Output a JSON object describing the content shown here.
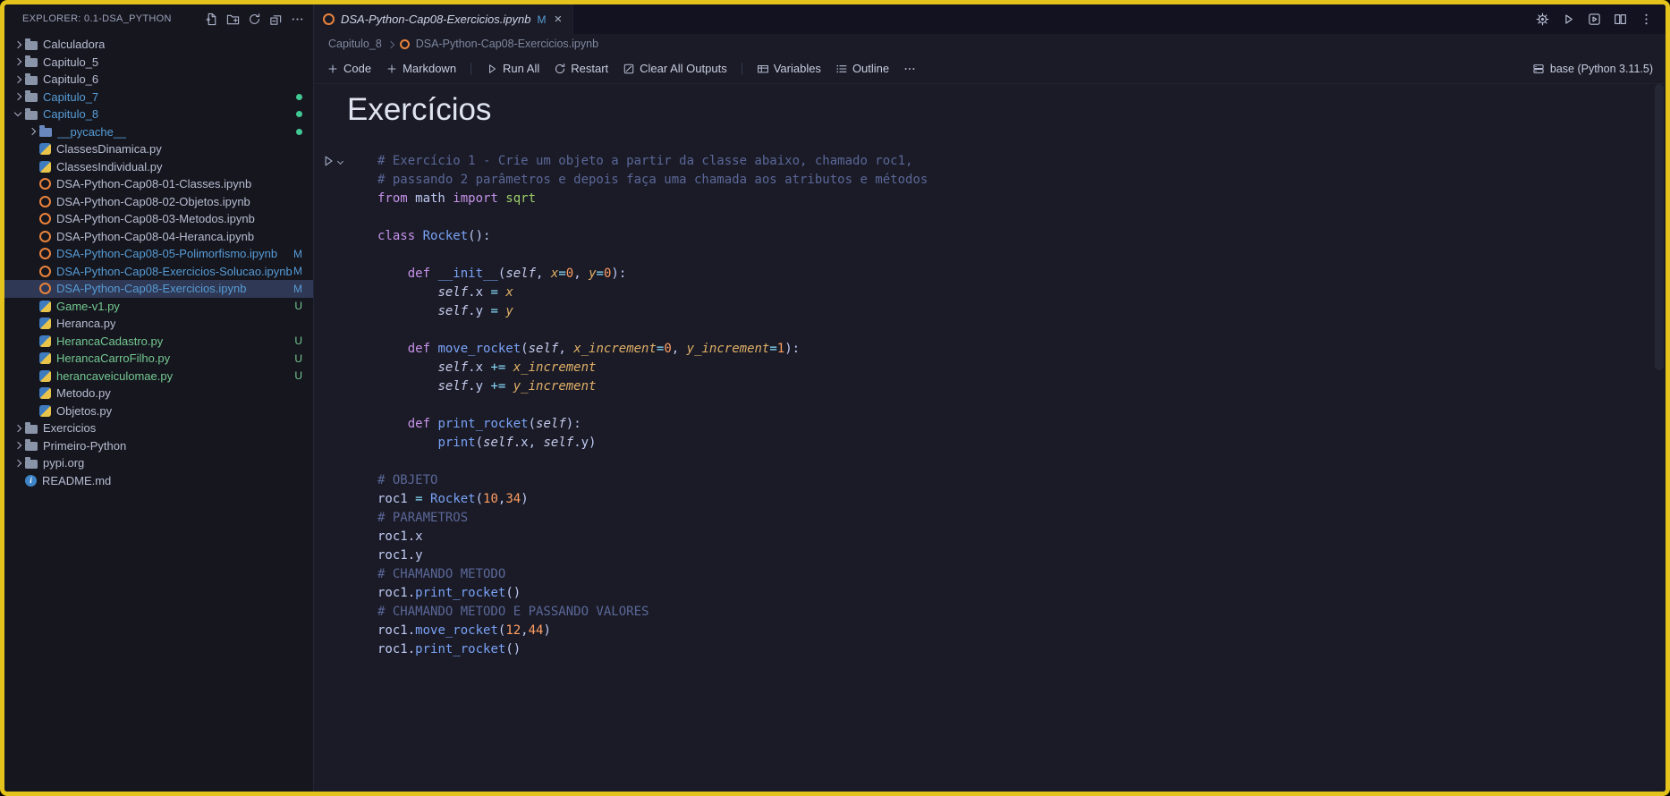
{
  "theme": {
    "frame": "#e4c31c",
    "bg": "#1a1b26",
    "bg-side": "#16161e",
    "tabbar": "#121220",
    "fg": "#c0caf5",
    "cm": "#5b6798",
    "kw": "#c792ea",
    "fn": "#7aa2f7",
    "gr": "#9ece6a",
    "nu": "#ff9e64",
    "op": "#89ddff",
    "pr": "#e0af68",
    "mod": "#569cd6",
    "new": "#73c991",
    "jup": "#e8823c",
    "sel": "#2f3854",
    "dot": "#41c994"
  },
  "explorer": {
    "title": "EXPLORER: 0.1-DSA_PYTHON",
    "actions": [
      "new-file",
      "new-folder",
      "refresh",
      "collapse-all",
      "more-h"
    ],
    "items": [
      {
        "label": "Calculadora",
        "icon": "folder",
        "depth": 0,
        "chev": "right"
      },
      {
        "label": "Capitulo_5",
        "icon": "folder",
        "depth": 0,
        "chev": "right"
      },
      {
        "label": "Capitulo_6",
        "icon": "folder",
        "depth": 0,
        "chev": "right"
      },
      {
        "label": "Capitulo_7",
        "icon": "folder",
        "depth": 0,
        "chev": "right",
        "cls": "mod",
        "dot": true
      },
      {
        "label": "Capitulo_8",
        "icon": "folder",
        "depth": 0,
        "chev": "down",
        "cls": "mod",
        "dot": true
      },
      {
        "label": "__pycache__",
        "icon": "folder-blue",
        "depth": 1,
        "chev": "right",
        "cls": "mod",
        "dot": true
      },
      {
        "label": "ClassesDinamica.py",
        "icon": "py",
        "depth": 1
      },
      {
        "label": "ClassesIndividual.py",
        "icon": "py",
        "depth": 1
      },
      {
        "label": "DSA-Python-Cap08-01-Classes.ipynb",
        "icon": "ipynb",
        "depth": 1
      },
      {
        "label": "DSA-Python-Cap08-02-Objetos.ipynb",
        "icon": "ipynb",
        "depth": 1
      },
      {
        "label": "DSA-Python-Cap08-03-Metodos.ipynb",
        "icon": "ipynb",
        "depth": 1
      },
      {
        "label": "DSA-Python-Cap08-04-Heranca.ipynb",
        "icon": "ipynb",
        "depth": 1
      },
      {
        "label": "DSA-Python-Cap08-05-Polimorfismo.ipynb",
        "icon": "ipynb",
        "depth": 1,
        "cls": "mod",
        "badge": "M"
      },
      {
        "label": "DSA-Python-Cap08-Exercicios-Solucao.ipynb",
        "icon": "ipynb",
        "depth": 1,
        "cls": "mod",
        "badge": "M"
      },
      {
        "label": "DSA-Python-Cap08-Exercicios.ipynb",
        "icon": "ipynb",
        "depth": 1,
        "cls": "mod",
        "badge": "M",
        "selected": true
      },
      {
        "label": "Game-v1.py",
        "icon": "py",
        "depth": 1,
        "cls": "new",
        "badge": "U"
      },
      {
        "label": "Heranca.py",
        "icon": "py",
        "depth": 1
      },
      {
        "label": "HerancaCadastro.py",
        "icon": "py",
        "depth": 1,
        "cls": "new",
        "badge": "U"
      },
      {
        "label": "HerancaCarroFilho.py",
        "icon": "py",
        "depth": 1,
        "cls": "new",
        "badge": "U"
      },
      {
        "label": "herancaveiculomae.py",
        "icon": "py",
        "depth": 1,
        "cls": "new",
        "badge": "U"
      },
      {
        "label": "Metodo.py",
        "icon": "py",
        "depth": 1
      },
      {
        "label": "Objetos.py",
        "icon": "py",
        "depth": 1
      },
      {
        "label": "Exercicios",
        "icon": "folder",
        "depth": 0,
        "chev": "right"
      },
      {
        "label": "Primeiro-Python",
        "icon": "folder",
        "depth": 0,
        "chev": "right"
      },
      {
        "label": "pypi.org",
        "icon": "folder",
        "depth": 0,
        "chev": "right"
      },
      {
        "label": "README.md",
        "icon": "info",
        "depth": 0
      }
    ]
  },
  "editor": {
    "tab": {
      "label": "DSA-Python-Cap08-Exercicios.ipynb",
      "modified": "M"
    },
    "actions": [
      "gear",
      "play",
      "kernel-box",
      "split",
      "more-v"
    ],
    "breadcrumbs": [
      "Capitulo_8",
      "DSA-Python-Cap08-Exercicios.ipynb"
    ],
    "toolbar": {
      "items": [
        {
          "icon": "plus",
          "label": "Code"
        },
        {
          "icon": "plus",
          "label": "Markdown"
        },
        {
          "divider": true
        },
        {
          "icon": "play",
          "label": "Run All"
        },
        {
          "icon": "restart",
          "label": "Restart"
        },
        {
          "icon": "clear",
          "label": "Clear All Outputs"
        },
        {
          "divider": true
        },
        {
          "icon": "variables",
          "label": "Variables"
        },
        {
          "icon": "outline",
          "label": "Outline"
        },
        {
          "icon": "more-h",
          "label": ""
        }
      ],
      "kernel": "base (Python 3.11.5)"
    },
    "markdown_heading": "Exercícios",
    "code": {
      "lines": [
        [
          [
            "cm",
            "# Exercício 1 - Crie um objeto a partir da classe abaixo, chamado roc1,"
          ]
        ],
        [
          [
            "cm",
            "# passando 2 parâmetros e depois faça uma chamada aos atributos e métodos"
          ]
        ],
        [
          [
            "kw",
            "from"
          ],
          [
            "pl",
            " math "
          ],
          [
            "kw",
            "import"
          ],
          [
            "gr",
            " sqrt"
          ]
        ],
        [],
        [
          [
            "kw",
            "class"
          ],
          [
            "pl",
            " "
          ],
          [
            "fn",
            "Rocket"
          ],
          [
            "pl",
            "():"
          ]
        ],
        [],
        [
          [
            "pl",
            "    "
          ],
          [
            "kw",
            "def"
          ],
          [
            "pl",
            " "
          ],
          [
            "fn",
            "__init__"
          ],
          [
            "pl",
            "("
          ],
          [
            "sf",
            "self"
          ],
          [
            "pl",
            ", "
          ],
          [
            "pr",
            "x"
          ],
          [
            "op",
            "="
          ],
          [
            "nu",
            "0"
          ],
          [
            "pl",
            ", "
          ],
          [
            "pr",
            "y"
          ],
          [
            "op",
            "="
          ],
          [
            "nu",
            "0"
          ],
          [
            "pl",
            "):"
          ]
        ],
        [
          [
            "pl",
            "        "
          ],
          [
            "sf",
            "self"
          ],
          [
            "pl",
            ".x "
          ],
          [
            "op",
            "="
          ],
          [
            "pl",
            " "
          ],
          [
            "pr",
            "x"
          ]
        ],
        [
          [
            "pl",
            "        "
          ],
          [
            "sf",
            "self"
          ],
          [
            "pl",
            ".y "
          ],
          [
            "op",
            "="
          ],
          [
            "pl",
            " "
          ],
          [
            "pr",
            "y"
          ]
        ],
        [],
        [
          [
            "pl",
            "    "
          ],
          [
            "kw",
            "def"
          ],
          [
            "pl",
            " "
          ],
          [
            "fn",
            "move_rocket"
          ],
          [
            "pl",
            "("
          ],
          [
            "sf",
            "self"
          ],
          [
            "pl",
            ", "
          ],
          [
            "pr",
            "x_increment"
          ],
          [
            "op",
            "="
          ],
          [
            "nu",
            "0"
          ],
          [
            "pl",
            ", "
          ],
          [
            "pr",
            "y_increment"
          ],
          [
            "op",
            "="
          ],
          [
            "nu",
            "1"
          ],
          [
            "pl",
            "):"
          ]
        ],
        [
          [
            "pl",
            "        "
          ],
          [
            "sf",
            "self"
          ],
          [
            "pl",
            ".x "
          ],
          [
            "op",
            "+="
          ],
          [
            "pl",
            " "
          ],
          [
            "pr",
            "x_increment"
          ]
        ],
        [
          [
            "pl",
            "        "
          ],
          [
            "sf",
            "self"
          ],
          [
            "pl",
            ".y "
          ],
          [
            "op",
            "+="
          ],
          [
            "pl",
            " "
          ],
          [
            "pr",
            "y_increment"
          ]
        ],
        [],
        [
          [
            "pl",
            "    "
          ],
          [
            "kw",
            "def"
          ],
          [
            "pl",
            " "
          ],
          [
            "fn",
            "print_rocket"
          ],
          [
            "pl",
            "("
          ],
          [
            "sf",
            "self"
          ],
          [
            "pl",
            "):"
          ]
        ],
        [
          [
            "pl",
            "        "
          ],
          [
            "fn",
            "print"
          ],
          [
            "pl",
            "("
          ],
          [
            "sf",
            "self"
          ],
          [
            "pl",
            ".x, "
          ],
          [
            "sf",
            "self"
          ],
          [
            "pl",
            ".y)"
          ]
        ],
        [],
        [
          [
            "cm",
            "# OBJETO"
          ]
        ],
        [
          [
            "pl",
            "roc1 "
          ],
          [
            "op",
            "="
          ],
          [
            "pl",
            " "
          ],
          [
            "fn",
            "Rocket"
          ],
          [
            "pl",
            "("
          ],
          [
            "nu",
            "10"
          ],
          [
            "pl",
            ","
          ],
          [
            "nu",
            "34"
          ],
          [
            "pl",
            ")"
          ]
        ],
        [
          [
            "cm",
            "# PARAMETROS"
          ]
        ],
        [
          [
            "pl",
            "roc1.x"
          ]
        ],
        [
          [
            "pl",
            "roc1.y"
          ]
        ],
        [
          [
            "cm",
            "# CHAMANDO METODO"
          ]
        ],
        [
          [
            "pl",
            "roc1."
          ],
          [
            "fn",
            "print_rocket"
          ],
          [
            "pl",
            "()"
          ]
        ],
        [
          [
            "cm",
            "# CHAMANDO METODO E PASSANDO VALORES"
          ]
        ],
        [
          [
            "pl",
            "roc1."
          ],
          [
            "fn",
            "move_rocket"
          ],
          [
            "pl",
            "("
          ],
          [
            "nu",
            "12"
          ],
          [
            "pl",
            ","
          ],
          [
            "nu",
            "44"
          ],
          [
            "pl",
            ")"
          ]
        ],
        [
          [
            "pl",
            "roc1."
          ],
          [
            "fn",
            "print_rocket"
          ],
          [
            "pl",
            "()"
          ]
        ]
      ]
    }
  }
}
